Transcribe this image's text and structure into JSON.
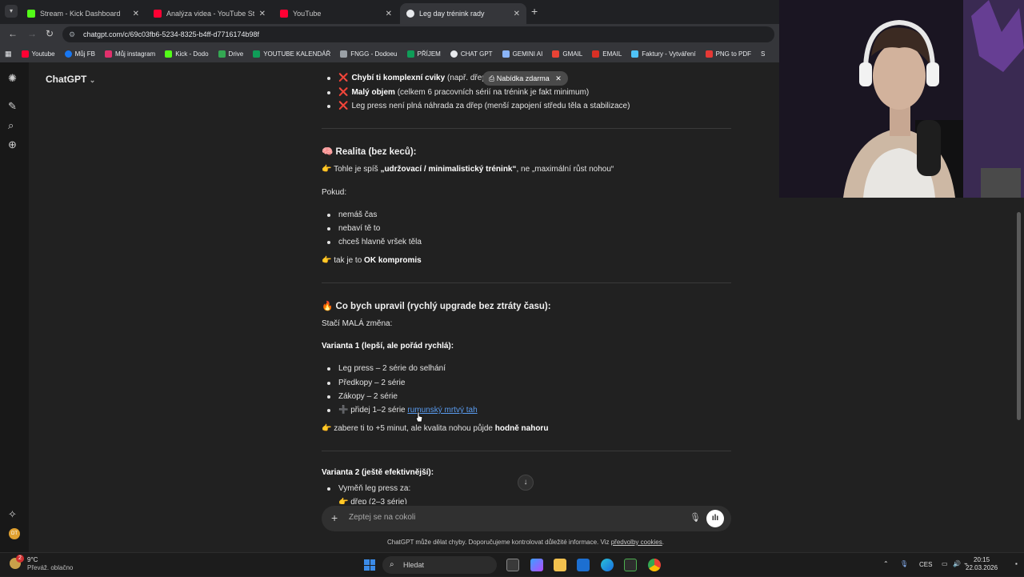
{
  "browser": {
    "tabs": [
      {
        "title": "Stream - Kick Dashboard",
        "active": false,
        "favicon_color": "#53fc18"
      },
      {
        "title": "Analýza videa - YouTube Studio",
        "active": false,
        "favicon_color": "#ff0033"
      },
      {
        "title": "YouTube",
        "active": false,
        "favicon_color": "#ff0033"
      },
      {
        "title": "Leg day trénink rady",
        "active": true,
        "favicon_color": "#e8eaed"
      }
    ],
    "url": "chatgpt.com/c/69c03fb6-5234-8325-b4ff-d7716174b98f",
    "bookmarks": [
      {
        "label": "Youtube",
        "color": "#ff0033"
      },
      {
        "label": "Můj FB",
        "color": "#1877f2"
      },
      {
        "label": "Můj instagram",
        "color": "#e1306c"
      },
      {
        "label": "Kick - Dodo",
        "color": "#53fc18"
      },
      {
        "label": "Drive",
        "color": "#34a853"
      },
      {
        "label": "YOUTUBE KALENDÁŘ",
        "color": "#0f9d58"
      },
      {
        "label": "FNGG - Dodoeu",
        "color": "#9aa0a6"
      },
      {
        "label": "PŘÍJEM",
        "color": "#0f9d58"
      },
      {
        "label": "CHAT GPT",
        "color": "#e8eaed"
      },
      {
        "label": "GEMINI AI",
        "color": "#8ab4f8"
      },
      {
        "label": "GMAIL",
        "color": "#ea4335"
      },
      {
        "label": "EMAIL",
        "color": "#d93025"
      },
      {
        "label": "Faktury - Vytváření",
        "color": "#4fc3f7"
      },
      {
        "label": "PNG to PDF",
        "color": "#e53935"
      },
      {
        "label": "S",
        "color": "#e8eaed"
      }
    ]
  },
  "app": {
    "model_label": "ChatGPT",
    "offer_label": "Nabídka zdarma",
    "top_bullets": [
      {
        "x": "❌",
        "bold": "Chybí ti komplexní cviky",
        "rest": " (např. dřep, rumunský mrtvý tah)"
      },
      {
        "x": "❌",
        "bold": "Malý objem",
        "rest": " (celkem 6 pracovních sérií na trénink je fakt minimum)"
      },
      {
        "x": "❌",
        "bold": "",
        "rest": "Leg press není plná náhrada za dřep (menší zapojení středu těla a stabilizace)"
      }
    ],
    "section_reality": {
      "heading": "Realita (bez keců):",
      "line1_pre": "Tohle je spíš ",
      "line1_bold": "„udržovací / minimalistický trénink“",
      "line1_post": ", ne „maximální růst nohou“",
      "pokud": "Pokud:",
      "bullets": [
        "nemáš čas",
        "nebaví tě to",
        "chceš hlavně vršek těla"
      ],
      "conclusion_pre": "tak je to ",
      "conclusion_bold": "OK kompromis"
    },
    "section_upgrade": {
      "heading": "Co bych upravil (rychlý upgrade bez ztráty času):",
      "intro": "Stačí MALÁ změna:",
      "variant1_title": "Varianta 1 (lepší, ale pořád rychlá):",
      "variant1_bullets": [
        "Leg press – 2 série do selhání",
        "Předkopy – 2 série",
        "Zákopy – 2 série"
      ],
      "add_pre": "přidej 1–2 série ",
      "add_link": "rumunský mrtvý tah",
      "summary_pre": "zabere ti to +5 minut, ale kvalita nohou půjde ",
      "summary_bold": "hodně nahoru",
      "variant2_title": "Varianta 2 (ještě efektivnější):",
      "variant2_bullets": [
        "Vyměň leg press za:"
      ],
      "variant2_sub": "dřep (2–3 série)"
    },
    "composer_placeholder": "Zeptej se na cokoli",
    "disclaimer_pre": "ChatGPT může dělat chyby. Doporučujeme kontrolovat důležité informace. Viz ",
    "disclaimer_link": "předvolby cookies",
    "disclaimer_post": "."
  },
  "taskbar": {
    "weather_temp": "9°C",
    "weather_desc": "Převáž. oblačno",
    "weather_badge": "2",
    "search_label": "Hledat",
    "language": "CES",
    "time": "20:15",
    "date": "22.03.2026"
  }
}
